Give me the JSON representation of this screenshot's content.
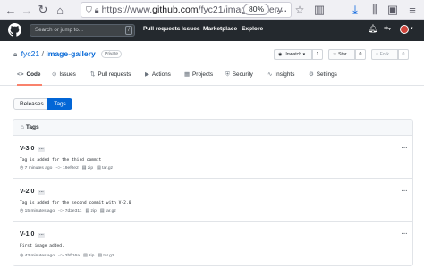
{
  "browser": {
    "url_prefix": "https://www.",
    "url_host": "github.com",
    "url_path": "/fyc21/image-gallery",
    "zoom": "80%"
  },
  "header": {
    "search_placeholder": "Search or jump to...",
    "search_shortcut": "/",
    "nav": [
      "Pull requests",
      "Issues",
      "Marketplace",
      "Explore"
    ],
    "new_label": "+"
  },
  "repo": {
    "owner": "fyc21",
    "separator": "/",
    "name": "image-gallery",
    "visibility": "Private",
    "watch_label": "Unwatch",
    "watch_count": "1",
    "star_label": "Star",
    "star_count": "0",
    "fork_label": "Fork",
    "fork_count": "0"
  },
  "tabs": [
    {
      "label": "Code",
      "icon": "<>",
      "icon_name": "code-icon"
    },
    {
      "label": "Issues",
      "icon": "⊙",
      "icon_name": "issue-icon"
    },
    {
      "label": "Pull requests",
      "icon": "⇅",
      "icon_name": "pull-request-icon"
    },
    {
      "label": "Actions",
      "icon": "▶",
      "icon_name": "actions-icon"
    },
    {
      "label": "Projects",
      "icon": "▦",
      "icon_name": "projects-icon"
    },
    {
      "label": "Security",
      "icon": "⛨",
      "icon_name": "shield-icon"
    },
    {
      "label": "Insights",
      "icon": "∿",
      "icon_name": "graph-icon"
    },
    {
      "label": "Settings",
      "icon": "⚙",
      "icon_name": "gear-icon"
    }
  ],
  "subnav": {
    "releases": "Releases",
    "tags": "Tags"
  },
  "tags_box": {
    "title": "Tags",
    "items": [
      {
        "name": "V-3.0",
        "message": "Tag is added for the third commit",
        "time": "7 minutes ago",
        "sha": "19ef0e2",
        "zip": "zip",
        "tar": "tar.gz"
      },
      {
        "name": "V-2.0",
        "message": "Tag is added for the second commit with V-2.0",
        "time": "15 minutes ago",
        "sha": "7d2e311",
        "zip": "zip",
        "tar": "tar.gz"
      },
      {
        "name": "V-1.0",
        "message": "First image added.",
        "time": "43 minutes ago",
        "sha": "2bff16a",
        "zip": "zip",
        "tar": "tar.gz"
      }
    ]
  },
  "colors": {
    "accent": "#0366d6",
    "tab_underline": "#f9826c",
    "header_bg": "#24292e"
  }
}
